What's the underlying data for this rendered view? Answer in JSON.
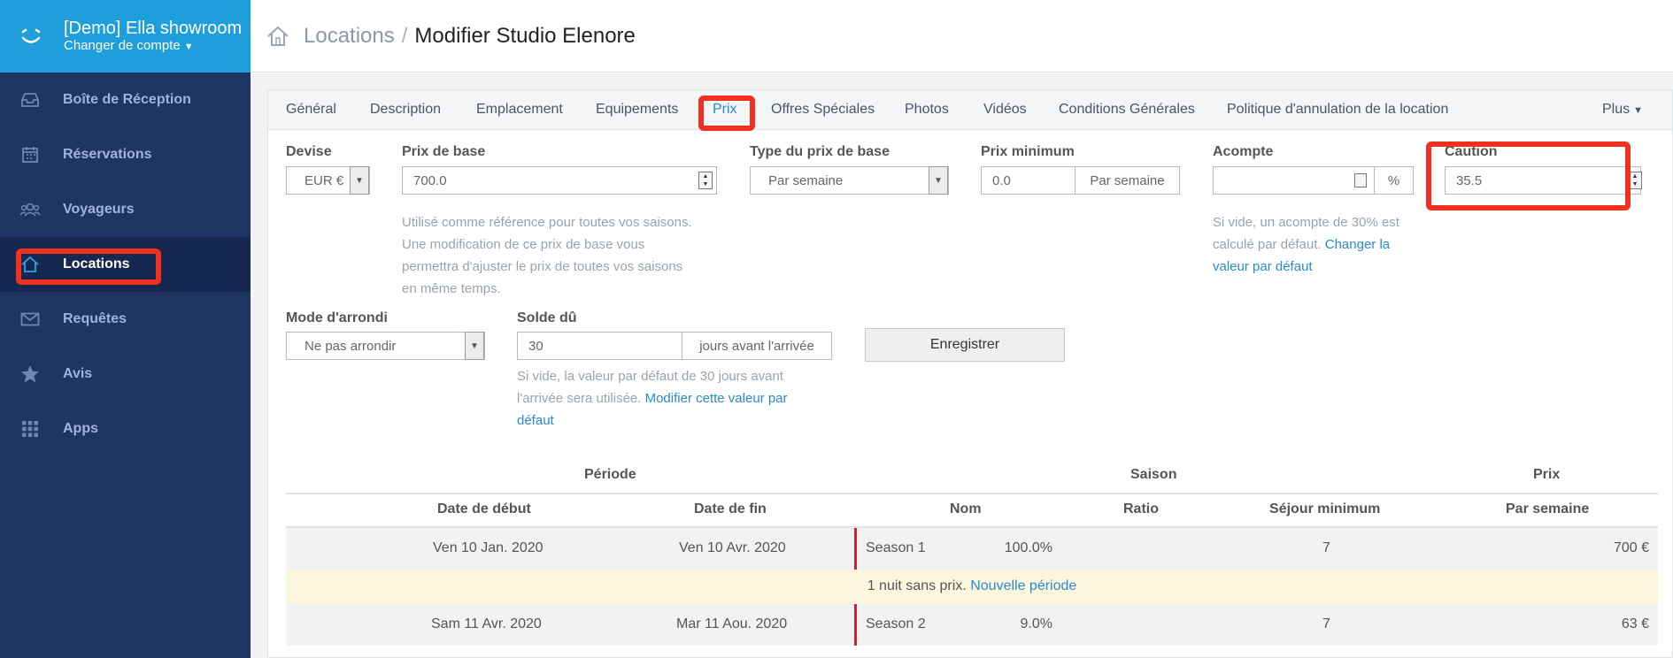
{
  "account": {
    "name": "[Demo] Ella showroom",
    "switch_label": "Changer de compte"
  },
  "sidebar": {
    "items": [
      {
        "label": "Boîte de Réception",
        "icon": "inbox-icon"
      },
      {
        "label": "Réservations",
        "icon": "calendar-icon"
      },
      {
        "label": "Voyageurs",
        "icon": "users-icon"
      },
      {
        "label": "Locations",
        "icon": "home-icon",
        "active": true
      },
      {
        "label": "Requêtes",
        "icon": "envelope-icon"
      },
      {
        "label": "Avis",
        "icon": "star-icon"
      },
      {
        "label": "Apps",
        "icon": "grid-icon"
      }
    ]
  },
  "header": {
    "breadcrumb": "Locations",
    "separator": "/",
    "page_title": "Modifier Studio Elenore"
  },
  "tabs": [
    "Général",
    "Description",
    "Emplacement",
    "Equipements",
    "Prix",
    "Offres Spéciales",
    "Photos",
    "Vidéos",
    "Conditions Générales",
    "Politique d'annulation de la location",
    "Plus"
  ],
  "form": {
    "devise": {
      "label": "Devise",
      "value": "EUR €"
    },
    "prix_base": {
      "label": "Prix de base",
      "value": "700.0",
      "help": [
        "Utilisé comme référence pour toutes vos saisons.",
        "Une modification de ce prix de base vous",
        "permettra d'ajuster le prix de toutes vos saisons",
        "en même temps."
      ]
    },
    "type_prix": {
      "label": "Type du prix de base",
      "value": "Par semaine"
    },
    "prix_min": {
      "label": "Prix minimum",
      "value": "0.0",
      "addon": "Par semaine"
    },
    "acompte": {
      "label": "Acompte",
      "value": "",
      "addon": "%",
      "help_1": "Si vide, un acompte de 30% est",
      "help_2": "calculé par défaut.",
      "link_1": "Changer la",
      "link_2": "valeur par défaut"
    },
    "caution": {
      "label": "Caution",
      "value": "35.5"
    },
    "arrondi": {
      "label": "Mode d'arrondi",
      "value": "Ne pas arrondir"
    },
    "solde": {
      "label": "Solde dû",
      "value": "30",
      "addon": "jours avant l'arrivée",
      "help_1": "Si vide, la valeur par défaut de 30 jours avant",
      "help_2": "l'arrivée sera utilisée.",
      "link_1": "Modifier cette valeur par",
      "link_2": "défaut"
    },
    "save_label": "Enregistrer"
  },
  "table": {
    "groups": {
      "periode": "Période",
      "saison": "Saison",
      "prix": "Prix"
    },
    "columns": [
      "Date de début",
      "Date de fin",
      "Nom",
      "Ratio",
      "Séjour minimum",
      "Par semaine"
    ],
    "rows": [
      {
        "start": "Ven 10 Jan. 2020",
        "end": "Ven 10 Avr. 2020",
        "name": "Season 1",
        "ratio": "100.0%",
        "min_stay": "7",
        "price": "700 €"
      },
      {
        "start": "Sam 11 Avr. 2020",
        "end": "Mar 11 Aou. 2020",
        "name": "Season 2",
        "ratio": "9.0%",
        "min_stay": "7",
        "price": "63 €"
      }
    ],
    "gap_note": "1 nuit sans prix.",
    "gap_link": "Nouvelle période"
  }
}
